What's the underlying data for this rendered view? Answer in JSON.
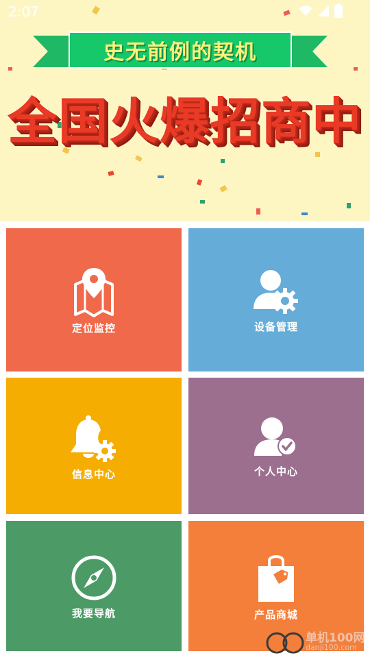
{
  "status_bar": {
    "time": "2:07"
  },
  "banner": {
    "ribbon_text": "史无前例的契机",
    "headline": "全国火爆招商中"
  },
  "tiles": [
    {
      "label": "定位监控",
      "color": "#f0694a",
      "icon": "map-pin-icon"
    },
    {
      "label": "设备管理",
      "color": "#65acd9",
      "icon": "user-gear-icon"
    },
    {
      "label": "信息中心",
      "color": "#f5ad02",
      "icon": "bell-gear-icon"
    },
    {
      "label": "个人中心",
      "color": "#9c6f8f",
      "icon": "user-check-icon"
    },
    {
      "label": "我要导航",
      "color": "#4c9b66",
      "icon": "compass-icon"
    },
    {
      "label": "产品商城",
      "color": "#f47f3b",
      "icon": "shopping-bag-icon"
    }
  ],
  "watermark": {
    "title": "单机100网",
    "subtitle": "danji100.com"
  }
}
